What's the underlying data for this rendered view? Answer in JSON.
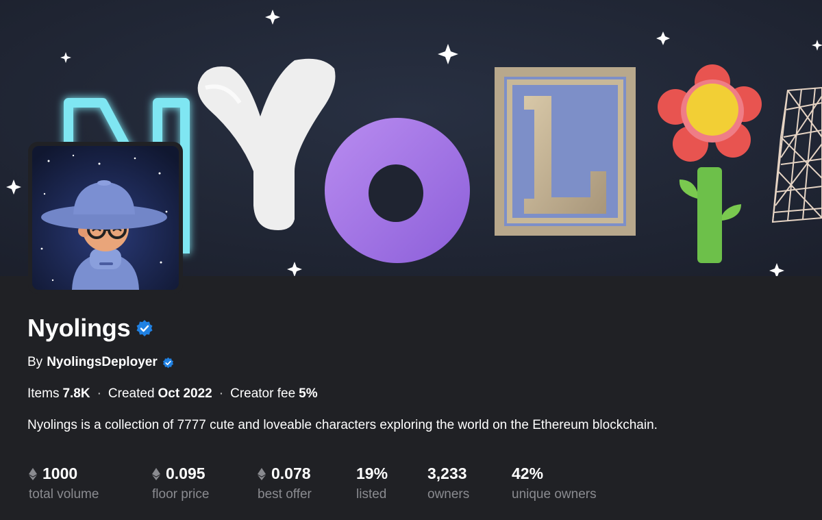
{
  "collection": {
    "name": "Nyolings",
    "by_prefix": "By",
    "creator": "NyolingsDeployer",
    "items_label": "Items",
    "items_value": "7.8K",
    "created_label": "Created",
    "created_value": "Oct 2022",
    "fee_label": "Creator fee",
    "fee_value": "5%",
    "separator": "·",
    "description": "Nyolings is a collection of 7777 cute and loveable characters exploring the world on the Ethereum blockchain."
  },
  "stats": [
    {
      "value": "1000",
      "label": "total volume",
      "currency_icon": "eth-icon"
    },
    {
      "value": "0.095",
      "label": "floor price",
      "currency_icon": "eth-icon"
    },
    {
      "value": "0.078",
      "label": "best offer",
      "currency_icon": "eth-icon"
    },
    {
      "value": "19%",
      "label": "listed"
    },
    {
      "value": "3,233",
      "label": "owners"
    },
    {
      "value": "42%",
      "label": "unique owners"
    }
  ],
  "banner": {
    "letters": [
      "N",
      "Y",
      "O",
      "L",
      "I"
    ]
  },
  "colors": {
    "background": "#202125",
    "banner_bg": "#1f2431",
    "verified": "#2081e2",
    "muted_label": "#8a8b90"
  }
}
